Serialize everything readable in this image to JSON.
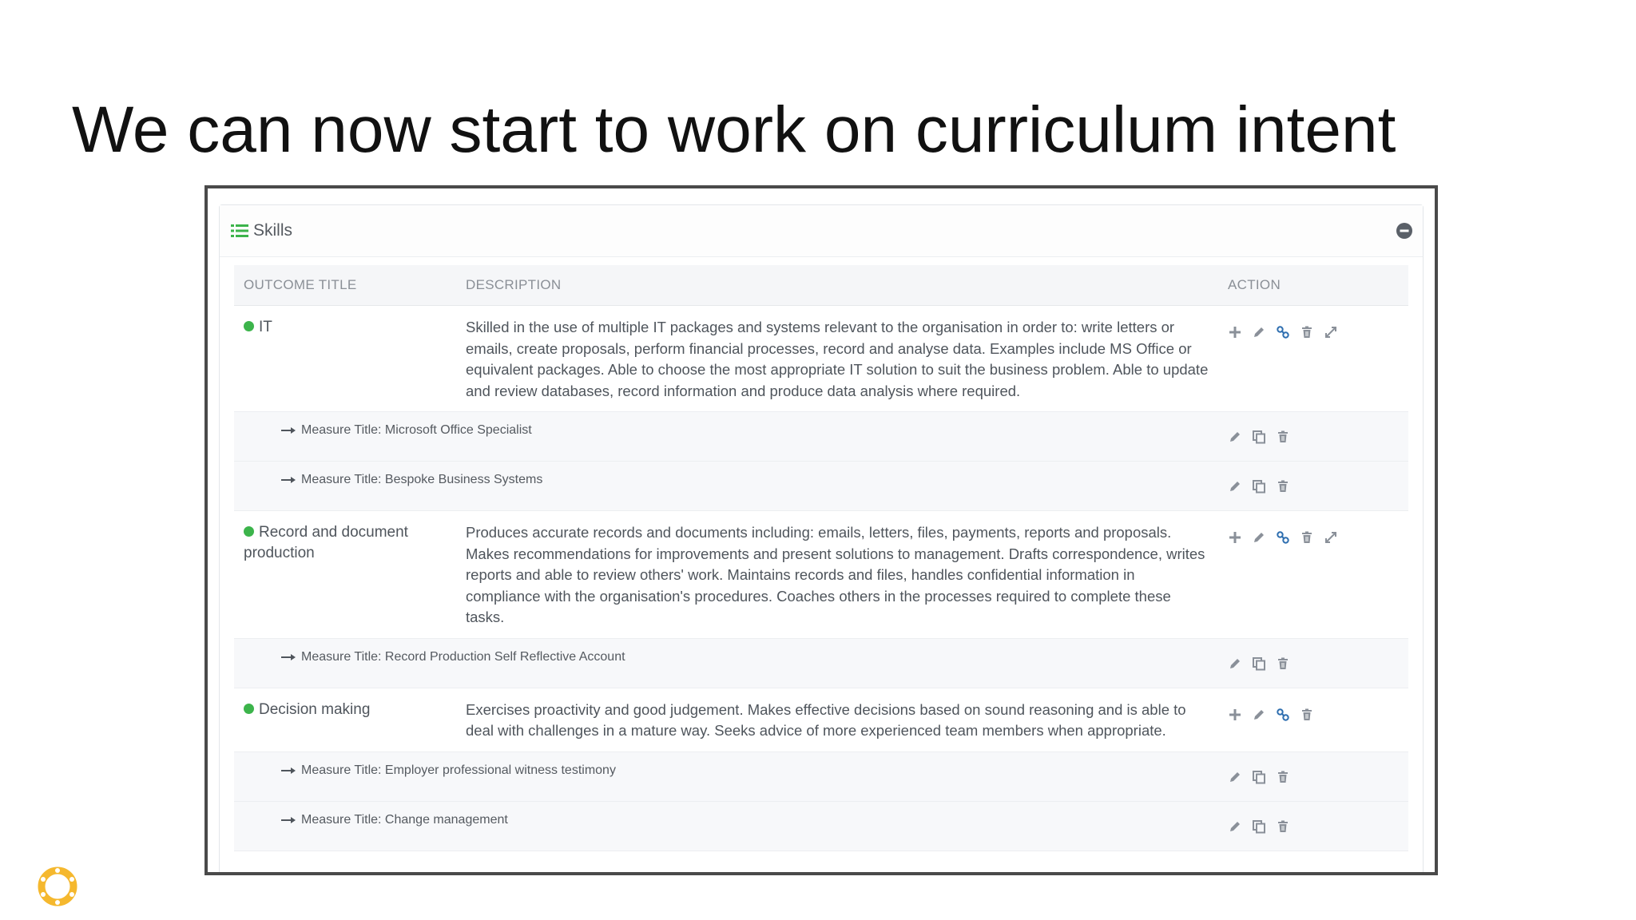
{
  "slide": {
    "title": "We can now start to work on curriculum intent"
  },
  "panel": {
    "title": "Skills",
    "icons": {
      "header": "list-icon",
      "collapse": "minus-circle-icon"
    }
  },
  "table": {
    "headers": {
      "outcome": "OUTCOME TITLE",
      "description": "DESCRIPTION",
      "action": "ACTION"
    }
  },
  "outcomes": [
    {
      "title": "IT",
      "description": "Skilled in the use of multiple IT packages and systems relevant to the organisation in order to: write letters or emails, create proposals, perform financial processes, record and analyse data. Examples include MS Office or equivalent packages. Able to choose the most appropriate IT solution to suit the business problem. Able to update and review databases, record information and produce data analysis where required.",
      "measures": [
        "Measure Title: Microsoft Office Specialist",
        "Measure Title: Bespoke Business Systems"
      ]
    },
    {
      "title": "Record and document production",
      "description": "Produces accurate records and documents including: emails, letters, files, payments, reports and proposals. Makes recommendations for improvements and present solutions to management. Drafts correspondence, writes reports and able to review others' work. Maintains records and files, handles confidential information in compliance with the organisation's procedures. Coaches others in the processes required to complete these tasks.",
      "measures": [
        "Measure Title: Record Production Self Reflective Account"
      ]
    },
    {
      "title": "Decision making",
      "description": "Exercises proactivity and good judgement. Makes effective decisions based on sound reasoning and is able to deal with challenges in a mature way. Seeks advice of more experienced team members when appropriate.",
      "measures": [
        "Measure Title: Employer professional witness testimony",
        "Measure Title: Change management"
      ]
    }
  ],
  "colors": {
    "status_dot": "#3cb44b",
    "icon": "#8a9099",
    "link_icon": "#2f6fb0",
    "logo": "#f5b82e"
  }
}
